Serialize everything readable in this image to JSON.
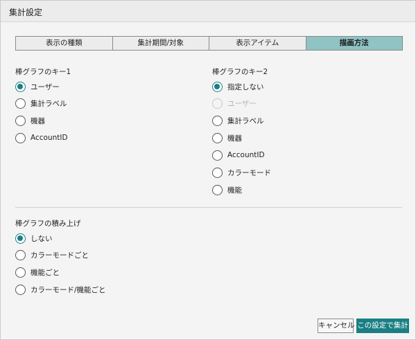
{
  "dialog": {
    "title": "集計設定"
  },
  "tabs": [
    {
      "label": "表示の種類",
      "active": false
    },
    {
      "label": "集計期間/対象",
      "active": false
    },
    {
      "label": "表示アイテム",
      "active": false
    },
    {
      "label": "描画方法",
      "active": true
    }
  ],
  "key1": {
    "title": "棒グラフのキー1",
    "options": [
      {
        "label": "ユーザー",
        "checked": true
      },
      {
        "label": "集計ラベル",
        "checked": false
      },
      {
        "label": "機器",
        "checked": false
      },
      {
        "label": "AccountID",
        "checked": false
      }
    ]
  },
  "key2": {
    "title": "棒グラフのキー2",
    "options": [
      {
        "label": "指定しない",
        "checked": true
      },
      {
        "label": "ユーザー",
        "checked": false,
        "disabled": true
      },
      {
        "label": "集計ラベル",
        "checked": false
      },
      {
        "label": "機器",
        "checked": false
      },
      {
        "label": "AccountID",
        "checked": false
      },
      {
        "label": "カラーモード",
        "checked": false
      },
      {
        "label": "機能",
        "checked": false
      }
    ]
  },
  "stack": {
    "title": "棒グラフの積み上げ",
    "options": [
      {
        "label": "しない",
        "checked": true
      },
      {
        "label": "カラーモードごと",
        "checked": false
      },
      {
        "label": "機能ごと",
        "checked": false
      },
      {
        "label": "カラーモード/機能ごと",
        "checked": false
      }
    ]
  },
  "buttons": {
    "cancel": "キャンセル",
    "submit": "この設定で集計"
  },
  "colors": {
    "accent": "#1a7f82",
    "active_tab": "#8fc3c4"
  }
}
